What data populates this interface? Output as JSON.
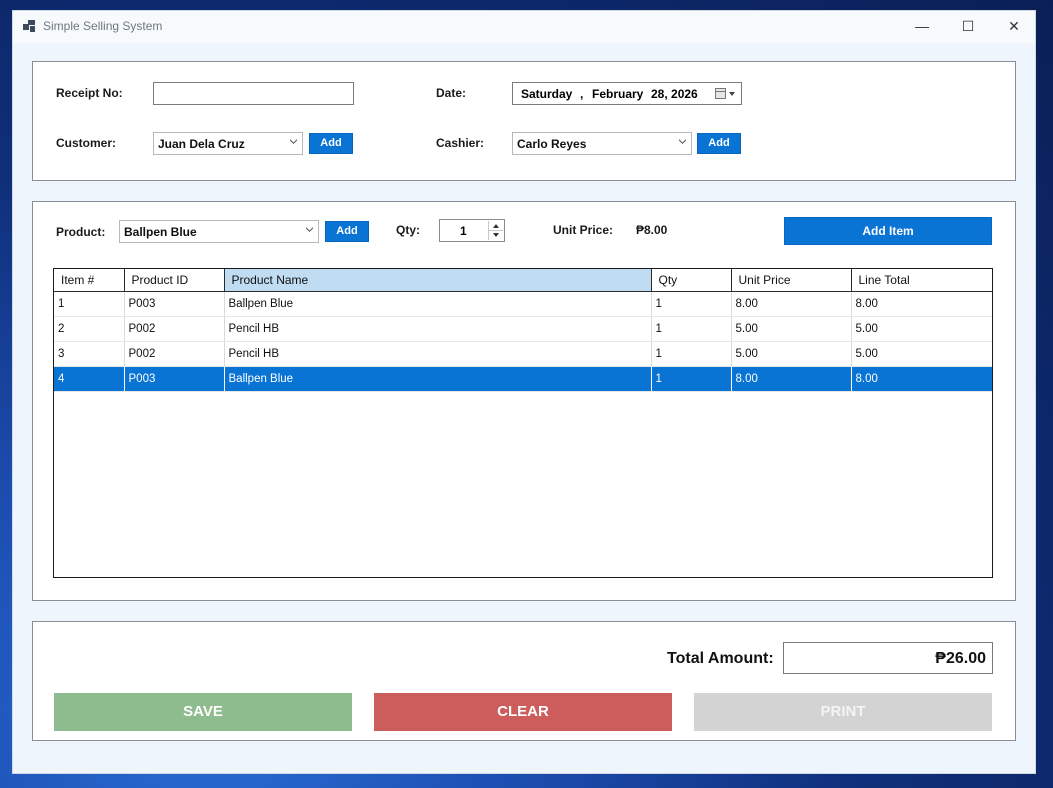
{
  "window": {
    "title": "Simple Selling System",
    "minimize": "—",
    "maximize": "☐",
    "close": "✕"
  },
  "header": {
    "receipt_label": "Receipt No:",
    "receipt_value": "",
    "date_label": "Date:",
    "date_day": "Saturday",
    "date_sep": ",",
    "date_month": "February",
    "date_daynum_year": "28, 2026",
    "customer_label": "Customer:",
    "customer_value": "Juan Dela Cruz",
    "customer_add": "Add",
    "cashier_label": "Cashier:",
    "cashier_value": "Carlo Reyes",
    "cashier_add": "Add"
  },
  "items": {
    "product_label": "Product:",
    "product_value": "Ballpen Blue",
    "product_add": "Add",
    "qty_label": "Qty:",
    "qty_value": "1",
    "unit_price_label": "Unit Price:",
    "unit_price_value": "₱8.00",
    "add_item": "Add Item",
    "columns": [
      "Item #",
      "Product ID",
      "Product Name",
      "Qty",
      "Unit Price",
      "Line Total"
    ],
    "rows": [
      [
        "1",
        "P003",
        "Ballpen Blue",
        "1",
        "8.00",
        "8.00"
      ],
      [
        "2",
        "P002",
        "Pencil HB",
        "1",
        "5.00",
        "5.00"
      ],
      [
        "3",
        "P002",
        "Pencil HB",
        "1",
        "5.00",
        "5.00"
      ],
      [
        "4",
        "P003",
        "Ballpen Blue",
        "1",
        "8.00",
        "8.00"
      ]
    ],
    "selected_row": 3,
    "selected_column": 2
  },
  "footer": {
    "total_label": "Total Amount:",
    "total_value": "₱26.00",
    "save": "SAVE",
    "clear": "CLEAR",
    "print": "PRINT"
  },
  "colors": {
    "accent": "#0a74d4",
    "save": "#8fbc8f",
    "clear": "#cd5c5c",
    "print": "#d3d3d3"
  }
}
